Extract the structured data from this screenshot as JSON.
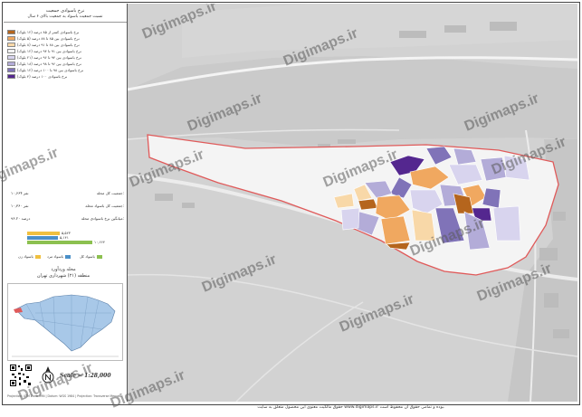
{
  "legend": {
    "title": "نرخ باسوادی جمعیت",
    "subtitle": "نسبت جمعیت باسواد به جمعیت بالای ۶ سال",
    "classes": [
      {
        "label": "نرخ باسوادی کمتر از ۸۵ درصد (۱۲ بلوک)",
        "color": "#b5651d"
      },
      {
        "label": "نرخ باسوادی بین ۸۵ تا ۸۸ درصد (۵ بلوک)",
        "color": "#f0a860"
      },
      {
        "label": "نرخ باسوادی بین ۸۸ تا ۹۱ درصد (۸ بلوک)",
        "color": "#f8d8a8"
      },
      {
        "label": "نرخ باسوادی بین ۹۱ تا ۹۴ درصد (۱۲ بلوک)",
        "color": "#f2f2f2"
      },
      {
        "label": "نرخ باسوادی بین ۹۴ تا ۹۶ درصد (۲۱ بلوک)",
        "color": "#d8d4ee"
      },
      {
        "label": "نرخ باسوادی بین ۹۶ تا ۹۸ درصد (۱۸ بلوک)",
        "color": "#b3acd8"
      },
      {
        "label": "نرخ باسوادی بین ۹۸ تا ۱۰۰ درصد (۱۲ بلوک)",
        "color": "#8073b8"
      },
      {
        "label": "نرخ باسوادی ۱۰۰ درصد (۴ بلوک)",
        "color": "#54278f"
      }
    ]
  },
  "stats": [
    {
      "key": "جمعیت کل محله:",
      "value": "۱۰,۶۶۴ نفر"
    },
    {
      "key": "جمعیت کل باسواد محله:",
      "value": "۱۰,۳۶۰ نفر"
    },
    {
      "key": "میانگین نرخ باسوادی محله:",
      "value": "۹۶.۲۰ درصد"
    }
  ],
  "bars": [
    {
      "label": "۵,۵۲۳",
      "color": "#f0c040",
      "fraction": 0.52
    },
    {
      "label": "۵,۱۴۱",
      "color": "#4a90c8",
      "fraction": 0.48
    },
    {
      "label": "۱۰,۶۶۴",
      "color": "#8cc050",
      "fraction": 1.0
    }
  ],
  "bar_legend": [
    "باسواد کل",
    "باسواد مرد",
    "باسواد زن"
  ],
  "bar_legend_colors": [
    "#8cc050",
    "#4a90c8",
    "#f0c040"
  ],
  "area": {
    "name": "محله وردآورد",
    "district": "منطقه (۲۱) شهرداری تهران"
  },
  "scale": "Scale = 1:28,000",
  "credit": "Projection: UTM Zone 39N | Datum: WGS 1984 | Projection: Transverse Mercator",
  "watermark": "Digimaps.ir",
  "footer": "حقوق مالکیت معنوی این محصول متعلق به سایت www.digimaps.ir بوده و تمامی حقوق آن محفوظ است.",
  "colors": {
    "boundary": "#e05a5a",
    "background": "#d2d2d2"
  }
}
